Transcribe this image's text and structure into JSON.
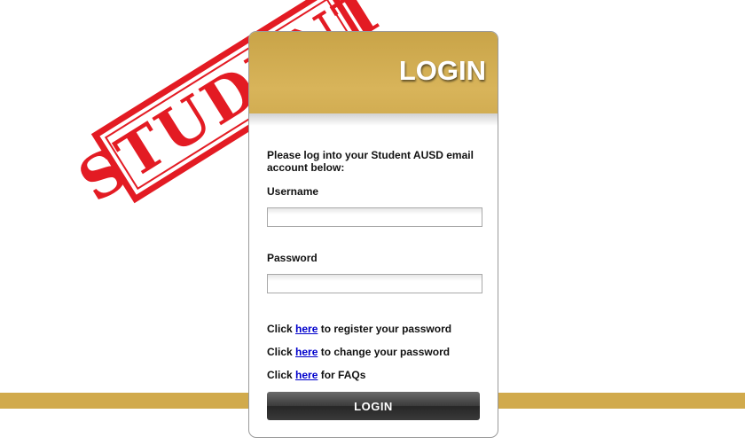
{
  "stamp": {
    "text": "STUDENT",
    "color": "#e31b23"
  },
  "card": {
    "title": "LOGIN",
    "header_color": "#d1aa4c",
    "intro": "Please log into your Student AUSD email account below:",
    "username": {
      "label": "Username",
      "value": "",
      "placeholder": ""
    },
    "password": {
      "label": "Password",
      "value": "",
      "placeholder": ""
    },
    "links": [
      {
        "prefix": "Click ",
        "link_text": "here",
        "suffix": " to register your password"
      },
      {
        "prefix": "Click ",
        "link_text": "here",
        "suffix": " to change your password"
      },
      {
        "prefix": "Click ",
        "link_text": "here",
        "suffix": " for FAQs"
      }
    ],
    "login_button_label": "LOGIN"
  },
  "colors": {
    "gold": "#d1aa4c",
    "link": "#0000cc"
  }
}
